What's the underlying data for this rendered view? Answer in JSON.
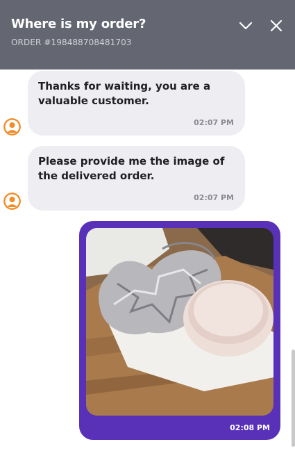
{
  "header": {
    "title": "Where is my order?",
    "order_label": "ORDER #198488708481703",
    "collapse_icon": "chevron-down-icon",
    "close_icon": "close-icon"
  },
  "messages": [
    {
      "sender": "agent",
      "text": "Thanks for waiting, you are a valuable customer.",
      "time": "02:07 PM"
    },
    {
      "sender": "agent",
      "text": "Please provide me the image of the delivered order.",
      "time": "02:07 PM"
    },
    {
      "sender": "user",
      "attachment_icon": "photo-icon",
      "time": "02:08 PM"
    }
  ],
  "colors": {
    "header_bg": "#646672",
    "incoming_bubble": "#eeedf2",
    "outgoing_bubble": "#5831b8",
    "avatar": "#f28c28"
  }
}
